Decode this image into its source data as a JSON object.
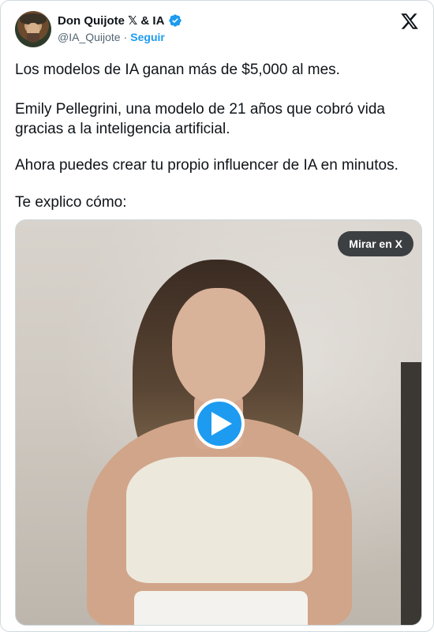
{
  "author": {
    "display_name": "Don Quijote 𝕏 & IA",
    "handle": "@IA_Quijote",
    "separator": "·",
    "follow_label": "Seguir",
    "verified": true
  },
  "platform_icon": "x-logo-icon",
  "post": {
    "paragraphs": [
      "Los modelos de IA ganan más de $5,000 al mes.",
      "Emily Pellegrini, una modelo de 21 años que cobró vida gracias a la inteligencia artificial.",
      "Ahora puedes crear tu propio influencer de IA en minutos.",
      "Te explico cómo:"
    ]
  },
  "media": {
    "type": "video",
    "watch_label": "Mirar en X",
    "play_icon": "play-icon"
  },
  "colors": {
    "accent": "#1d9bf0",
    "text": "#0f1419",
    "muted": "#536471"
  }
}
